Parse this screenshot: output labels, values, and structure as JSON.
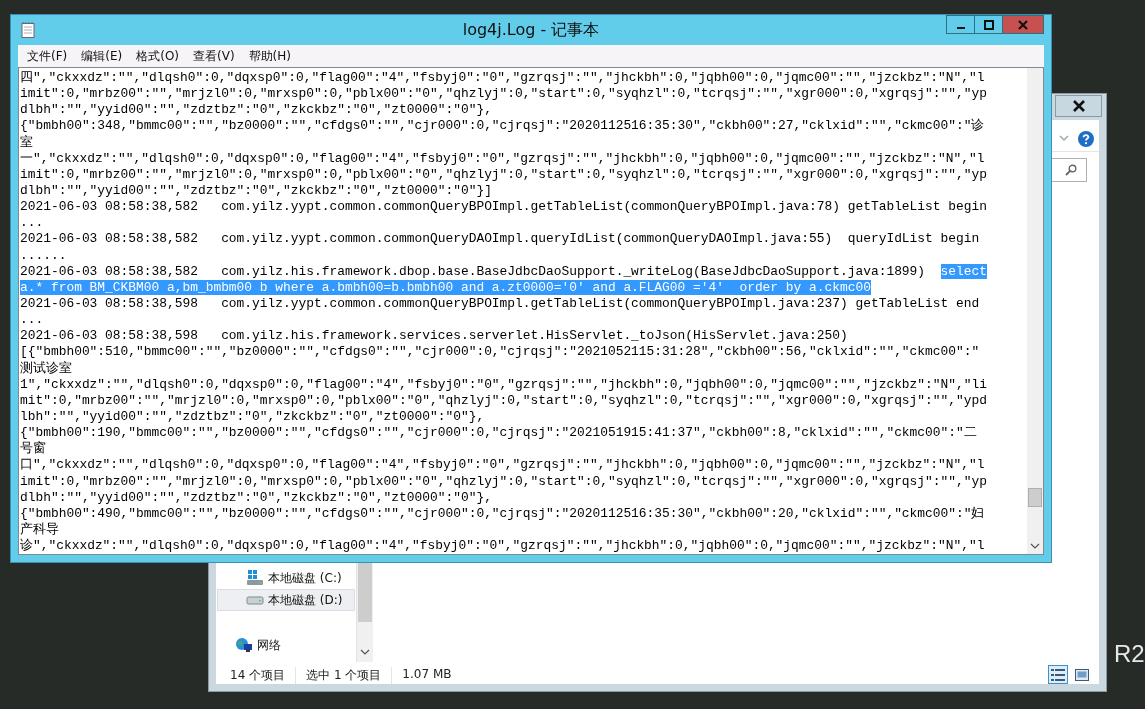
{
  "desktop": {
    "text": "R2"
  },
  "explorer": {
    "nav_items": [
      {
        "label": "本地磁盘 (C:)",
        "kind": "system-drive",
        "selected": false
      },
      {
        "label": "本地磁盘 (D:)",
        "kind": "drive",
        "selected": true
      },
      {
        "label": "网络",
        "kind": "network",
        "selected": false
      }
    ],
    "status": [
      "14 个项目",
      "选中 1 个项目",
      "1.07 MB"
    ],
    "view_buttons": [
      {
        "kind": "details",
        "selected": true
      },
      {
        "kind": "large-icons",
        "selected": false
      }
    ]
  },
  "notepad": {
    "title": "log4j.Log - 记事本",
    "menu": [
      "文件(F)",
      "编辑(E)",
      "格式(O)",
      "查看(V)",
      "帮助(H)"
    ],
    "lines": [
      {
        "parts": [
          {
            "text": "四\",\"ckxxdz\":\"\",\"dlqsh0\":0,\"dqxsp0\":0,\"flag00\":\"4\",\"fsbyj0\":\"0\",\"gzrqsj\":\"\",\"jhckbh\":0,\"jqbh00\":0,\"jqmc00\":\"\",\"jzckbz\":\"N\",\"l",
            "selected": false
          }
        ]
      },
      {
        "parts": [
          {
            "text": "imit\":0,\"mrbz00\":\"\",\"mrjzl0\":0,\"mrxsp0\":0,\"pblx00\":\"0\",\"qhzlyj\":0,\"start\":0,\"syqhzl\":0,\"tcrqsj\":\"\",\"xgr000\":0,\"xgrqsj\":\"\",\"yp",
            "selected": false
          }
        ]
      },
      {
        "parts": [
          {
            "text": "dlbh\":\"\",\"yyid00\":\"\",\"zdztbz\":\"0\",\"zkckbz\":\"0\",\"zt0000\":\"0\"},",
            "selected": false
          }
        ]
      },
      {
        "parts": [
          {
            "text": "{\"bmbh00\":348,\"bmmc00\":\"\",\"bz0000\":\"\",\"cfdgs0\":\"\",\"cjr000\":0,\"cjrqsj\":\"2020112516:35:30\",\"ckbh00\":27,\"cklxid\":\"\",\"ckmc00\":\"诊",
            "selected": false
          }
        ]
      },
      {
        "parts": [
          {
            "text": "室",
            "selected": false
          }
        ]
      },
      {
        "parts": [
          {
            "text": "一\",\"ckxxdz\":\"\",\"dlqsh0\":0,\"dqxsp0\":0,\"flag00\":\"4\",\"fsbyj0\":\"0\",\"gzrqsj\":\"\",\"jhckbh\":0,\"jqbh00\":0,\"jqmc00\":\"\",\"jzckbz\":\"N\",\"l",
            "selected": false
          }
        ]
      },
      {
        "parts": [
          {
            "text": "imit\":0,\"mrbz00\":\"\",\"mrjzl0\":0,\"mrxsp0\":0,\"pblx00\":\"0\",\"qhzlyj\":0,\"start\":0,\"syqhzl\":0,\"tcrqsj\":\"\",\"xgr000\":0,\"xgrqsj\":\"\",\"yp",
            "selected": false
          }
        ]
      },
      {
        "parts": [
          {
            "text": "dlbh\":\"\",\"yyid00\":\"\",\"zdztbz\":\"0\",\"zkckbz\":\"0\",\"zt0000\":\"0\"}]",
            "selected": false
          }
        ]
      },
      {
        "parts": [
          {
            "text": "2021-06-03 08:58:38,582   com.yilz.yypt.common.commonQueryBPOImpl.getTableList(commonQueryBPOImpl.java:78) getTableList begin",
            "selected": false
          }
        ]
      },
      {
        "parts": [
          {
            "text": "...",
            "selected": false
          }
        ]
      },
      {
        "parts": [
          {
            "text": "2021-06-03 08:58:38,582   com.yilz.yypt.common.commonQueryDAOImpl.queryIdList(commonQueryDAOImpl.java:55)  queryIdList begin",
            "selected": false
          }
        ]
      },
      {
        "parts": [
          {
            "text": "......",
            "selected": false
          }
        ]
      },
      {
        "parts": [
          {
            "text": "2021-06-03 08:58:38,582   com.yilz.his.framework.dbop.base.BaseJdbcDaoSupport._writeLog(BaseJdbcDaoSupport.java:1899)  ",
            "selected": false
          },
          {
            "text": "select",
            "selected": true
          }
        ]
      },
      {
        "parts": [
          {
            "text": "a.* from BM_CKBM00 a,bm_bmbm00 b where a.bmbh00=b.bmbh00 and a.zt0000='0' and a.FLAG00 ='4'  order by a.ckmc00",
            "selected": true
          }
        ]
      },
      {
        "parts": [
          {
            "text": "2021-06-03 08:58:38,598   com.yilz.yypt.common.commonQueryBPOImpl.getTableList(commonQueryBPOImpl.java:237) getTableList end",
            "selected": false
          }
        ]
      },
      {
        "parts": [
          {
            "text": "...",
            "selected": false
          }
        ]
      },
      {
        "parts": [
          {
            "text": "2021-06-03 08:58:38,598   com.yilz.his.framework.services.serverlet.HisServlet._toJson(HisServlet.java:250)",
            "selected": false
          }
        ]
      },
      {
        "parts": [
          {
            "text": "[{\"bmbh00\":510,\"bmmc00\":\"\",\"bz0000\":\"\",\"cfdgs0\":\"\",\"cjr000\":0,\"cjrqsj\":\"2021052115:31:28\",\"ckbh00\":56,\"cklxid\":\"\",\"ckmc00\":\"",
            "selected": false
          }
        ]
      },
      {
        "parts": [
          {
            "text": "测试诊室",
            "selected": false
          }
        ]
      },
      {
        "parts": [
          {
            "text": "1\",\"ckxxdz\":\"\",\"dlqsh0\":0,\"dqxsp0\":0,\"flag00\":\"4\",\"fsbyj0\":\"0\",\"gzrqsj\":\"\",\"jhckbh\":0,\"jqbh00\":0,\"jqmc00\":\"\",\"jzckbz\":\"N\",\"li",
            "selected": false
          }
        ]
      },
      {
        "parts": [
          {
            "text": "mit\":0,\"mrbz00\":\"\",\"mrjzl0\":0,\"mrxsp0\":0,\"pblx00\":\"0\",\"qhzlyj\":0,\"start\":0,\"syqhzl\":0,\"tcrqsj\":\"\",\"xgr000\":0,\"xgrqsj\":\"\",\"ypd",
            "selected": false
          }
        ]
      },
      {
        "parts": [
          {
            "text": "lbh\":\"\",\"yyid00\":\"\",\"zdztbz\":\"0\",\"zkckbz\":\"0\",\"zt0000\":\"0\"},",
            "selected": false
          }
        ]
      },
      {
        "parts": [
          {
            "text": "{\"bmbh00\":190,\"bmmc00\":\"\",\"bz0000\":\"\",\"cfdgs0\":\"\",\"cjr000\":0,\"cjrqsj\":\"2021051915:41:37\",\"ckbh00\":8,\"cklxid\":\"\",\"ckmc00\":\"二",
            "selected": false
          }
        ]
      },
      {
        "parts": [
          {
            "text": "号窗",
            "selected": false
          }
        ]
      },
      {
        "parts": [
          {
            "text": "口\",\"ckxxdz\":\"\",\"dlqsh0\":0,\"dqxsp0\":0,\"flag00\":\"4\",\"fsbyj0\":\"0\",\"gzrqsj\":\"\",\"jhckbh\":0,\"jqbh00\":0,\"jqmc00\":\"\",\"jzckbz\":\"N\",\"l",
            "selected": false
          }
        ]
      },
      {
        "parts": [
          {
            "text": "imit\":0,\"mrbz00\":\"\",\"mrjzl0\":0,\"mrxsp0\":0,\"pblx00\":\"0\",\"qhzlyj\":0,\"start\":0,\"syqhzl\":0,\"tcrqsj\":\"\",\"xgr000\":0,\"xgrqsj\":\"\",\"yp",
            "selected": false
          }
        ]
      },
      {
        "parts": [
          {
            "text": "dlbh\":\"\",\"yyid00\":\"\",\"zdztbz\":\"0\",\"zkckbz\":\"0\",\"zt0000\":\"0\"},",
            "selected": false
          }
        ]
      },
      {
        "parts": [
          {
            "text": "{\"bmbh00\":490,\"bmmc00\":\"\",\"bz0000\":\"\",\"cfdgs0\":\"\",\"cjr000\":0,\"cjrqsj\":\"2020112516:35:30\",\"ckbh00\":20,\"cklxid\":\"\",\"ckmc00\":\"妇",
            "selected": false
          }
        ]
      },
      {
        "parts": [
          {
            "text": "产科导",
            "selected": false
          }
        ]
      },
      {
        "parts": [
          {
            "text": "诊\",\"ckxxdz\":\"\",\"dlqsh0\":0,\"dqxsp0\":0,\"flag00\":\"4\",\"fsbyj0\":\"0\",\"gzrqsj\":\"\",\"jhckbh\":0,\"jqbh00\":0,\"jqmc00\":\"\",\"jzckbz\":\"N\",\"l",
            "selected": false
          }
        ]
      }
    ]
  }
}
